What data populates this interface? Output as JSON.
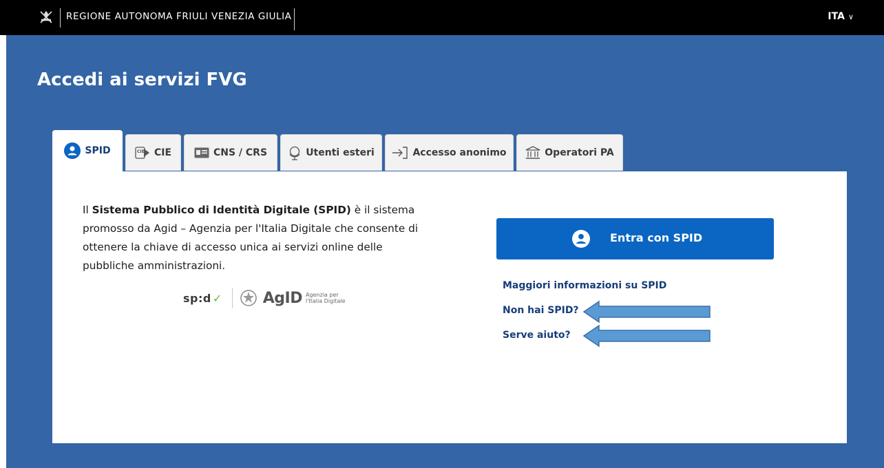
{
  "header": {
    "region_name": "REGIONE AUTONOMA FRIULI VENEZIA GIULIA",
    "language": "ITA"
  },
  "main": {
    "title": "Accedi ai servizi FVG"
  },
  "tabs": [
    {
      "label": "SPID",
      "icon": "spid-user-icon",
      "active": true
    },
    {
      "label": "CIE",
      "icon": "cie-card-icon",
      "active": false
    },
    {
      "label": "CNS / CRS",
      "icon": "id-card-icon",
      "active": false
    },
    {
      "label": "Utenti esteri",
      "icon": "globe-icon",
      "active": false
    },
    {
      "label": "Accesso anonimo",
      "icon": "login-arrow-icon",
      "active": false
    },
    {
      "label": "Operatori PA",
      "icon": "institution-icon",
      "active": false
    }
  ],
  "panel": {
    "description_prefix": "Il ",
    "description_bold": "Sistema Pubblico di Identità Digitale (SPID)",
    "description_suffix": " è il sistema promosso da Agid – Agenzia per l'Italia Digitale che consente di ottenere la chiave di accesso unica ai servizi online delle pubbliche amministrazioni.",
    "spid_logo_text": "sp:d",
    "agid_logo_text": "AgID",
    "agid_logo_sub_1": "Agenzia per",
    "agid_logo_sub_2": "l'Italia Digitale",
    "login_button": "Entra con SPID",
    "links": {
      "more_info": "Maggiori informazioni su SPID",
      "no_spid": "Non hai SPID?",
      "help": "Serve aiuto?"
    }
  },
  "colors": {
    "topbar": "#000000",
    "background": "#3465a6",
    "button": "#0a66c2",
    "link": "#173d7a",
    "annotation_arrow": "#5b9bd5"
  }
}
